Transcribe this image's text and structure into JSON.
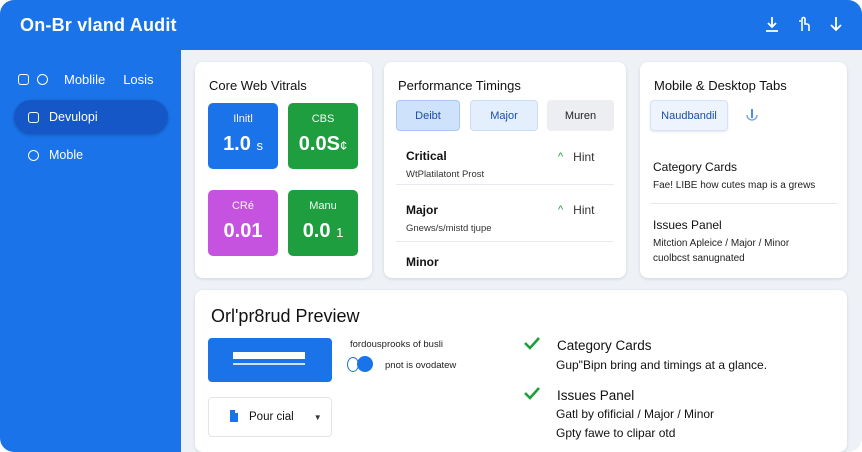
{
  "app": {
    "title": "On-Br vland Audit"
  },
  "topbar": {
    "icons": [
      "download-icon",
      "touch-icon",
      "arrow-down-icon"
    ]
  },
  "sidebar": {
    "header_label": "Moblile",
    "header_suffix": "Losis",
    "items": [
      {
        "label": "Devulopi",
        "active": true
      },
      {
        "label": "Moble",
        "active": false
      }
    ]
  },
  "core_vitals": {
    "title": "Core Web Vitrals",
    "tiles": [
      {
        "label": "Ilnitl",
        "value": "1.0",
        "unit": "s",
        "color": "#1a73e8"
      },
      {
        "label": "CBS",
        "value": "0.0S",
        "unit": "¢",
        "color": "#1e9e3e"
      },
      {
        "label": "CRé",
        "value": "0.01",
        "unit": "",
        "color": "#c653e0"
      },
      {
        "label": "Manu",
        "value": "0.0",
        "unit": "1",
        "color": "#1e9e3e"
      }
    ]
  },
  "timings": {
    "title": "Performance Timings",
    "tabs": [
      {
        "label": "Deibt"
      },
      {
        "label": "Major"
      },
      {
        "label": "Muren"
      }
    ],
    "rows": [
      {
        "name": "Critical",
        "sub": "WtPlatilatont Prost",
        "hint": "Hint",
        "caret": "^"
      },
      {
        "name": "Major",
        "sub": "Gnews/s/mistd tjupe",
        "hint": "Hint",
        "caret": "^"
      },
      {
        "name": "Minor",
        "sub": "",
        "hint": "",
        "caret": ""
      }
    ]
  },
  "mobile_desktop": {
    "title": "Mobile & Desktop Tabs",
    "tab_label": "Naudbandil",
    "category_title": "Category Cards",
    "category_sub": "Fae! LIBE  how cutes map is a grews",
    "issues_title": "Issues Panel",
    "issues_sub1": "Mitction Apleice / Major / Minor",
    "issues_sub2": "cuolbcst sanugnated"
  },
  "preview": {
    "title": "Orl'pr8rud Preview",
    "desc1": "fordousprooks of busli",
    "desc2": "pnot is ovodatew",
    "select_label": "Pour cial",
    "items": [
      {
        "title": "Category Cards",
        "sub": "Gup\"Bipn bring and timings at a glance."
      },
      {
        "title": "Issues Panel",
        "sub": "Gatl by ofificial  / Major / Minor",
        "sub2": "Gpty fawe to clipar otd"
      }
    ],
    "check_color": "#1e9e3e"
  }
}
